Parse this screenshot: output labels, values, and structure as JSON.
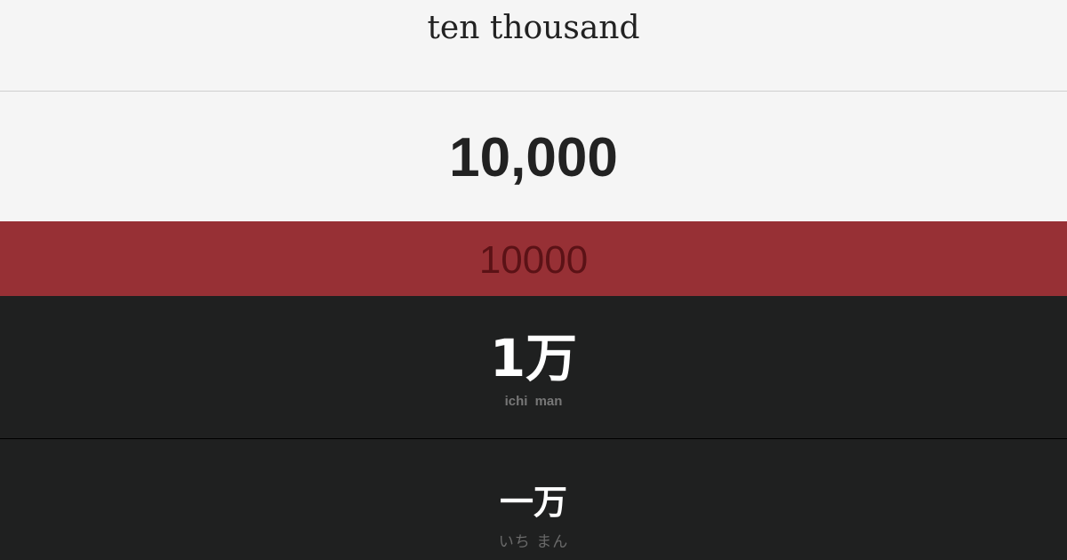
{
  "english": {
    "text": "ten thousand"
  },
  "arabic": {
    "text": "10,000"
  },
  "plain": {
    "text": "10000"
  },
  "mixed": {
    "text": "1万",
    "reading": "ichi man"
  },
  "kanji": {
    "text": "一万",
    "reading": "いち まん"
  },
  "colors": {
    "light_bg": "#f5f5f5",
    "accent_red": "#973035",
    "dark_bg": "#1f2020"
  }
}
